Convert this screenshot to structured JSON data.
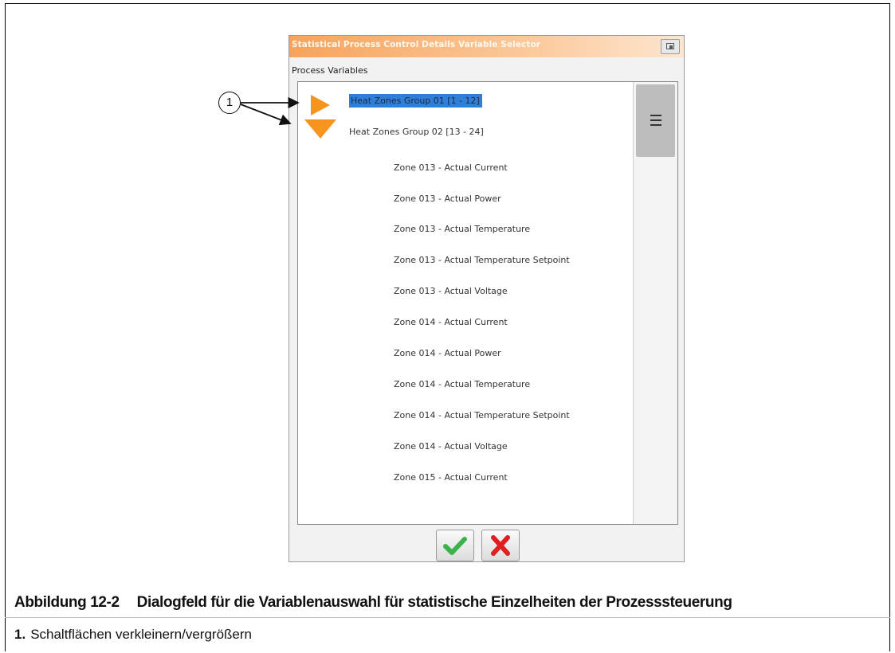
{
  "dialog": {
    "title": "Statistical Process Control Details Variable Selector",
    "section_label": "Process Variables",
    "groups": [
      {
        "label": "Heat Zones Group 01 [1 - 12]",
        "state": "collapsed",
        "selected": true
      },
      {
        "label": "Heat Zones Group 02 [13 - 24]",
        "state": "expanded",
        "selected": false
      }
    ],
    "items": [
      "Zone 013 - Actual Current",
      "Zone 013 - Actual Power",
      "Zone 013 - Actual Temperature",
      "Zone 013 - Actual Temperature Setpoint",
      "Zone 013 - Actual Voltage",
      "Zone 014 - Actual Current",
      "Zone 014 - Actual Power",
      "Zone 014 - Actual Temperature",
      "Zone 014 - Actual Temperature Setpoint",
      "Zone 014 - Actual Voltage",
      "Zone 015 - Actual Current"
    ],
    "ok_icon": "checkmark-icon",
    "cancel_icon": "x-icon",
    "colors": {
      "title_gradient_start": "#f7a35c",
      "arrow": "#f7941d",
      "selection": "#2f7fd8",
      "ok": "#3cb34a",
      "cancel": "#e02020"
    }
  },
  "callout": {
    "number": "1"
  },
  "caption": {
    "figure_number": "Abbildung 12-2",
    "text": "Dialogfeld für die Variablenauswahl für statistische Einzelheiten der Prozesssteuerung"
  },
  "legend": [
    {
      "number": "1.",
      "text": "Schaltflächen verkleinern/vergrößern"
    }
  ]
}
